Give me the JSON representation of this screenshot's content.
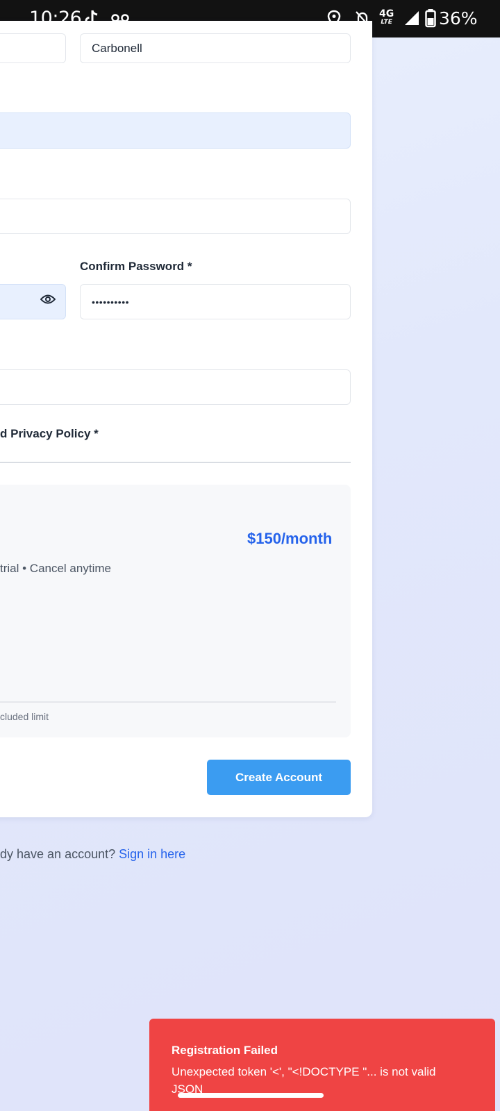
{
  "status_bar": {
    "time": "10:26",
    "network": "4G",
    "network_sub": "LTE",
    "battery": "36%"
  },
  "form": {
    "last_name_value": "Carbonell",
    "confirm_password_label": "Confirm Password *",
    "confirm_password_value": "••••••••••",
    "terms_label": "d Privacy Policy *"
  },
  "plan": {
    "price": "$150/month",
    "subtitle": "trial • Cancel anytime",
    "note": "cluded limit"
  },
  "actions": {
    "create_account": "Create Account"
  },
  "footer": {
    "prompt": "dy have an account?",
    "signin_link": "Sign in here"
  },
  "toast": {
    "title": "Registration Failed",
    "message": "Unexpected token '<', \"<!DOCTYPE \"... is not valid JSON"
  },
  "colors": {
    "accent": "#2563eb",
    "button": "#3b9cf1",
    "error": "#ef4444"
  }
}
